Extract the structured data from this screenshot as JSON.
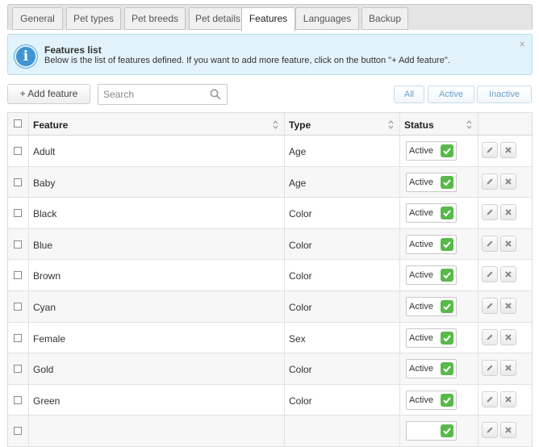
{
  "tabs": [
    {
      "label": "General"
    },
    {
      "label": "Pet types"
    },
    {
      "label": "Pet breeds"
    },
    {
      "label": "Pet details"
    },
    {
      "label": "Features"
    },
    {
      "label": "Languages"
    },
    {
      "label": "Backup"
    }
  ],
  "active_tab": "Features",
  "info": {
    "title": "Features list",
    "text": "Below is the list of features defined. If you want to add more feature, click on the button \"+ Add feature\".",
    "close": "×"
  },
  "toolbar": {
    "add_label": "+ Add feature",
    "search_placeholder": "Search",
    "filters": [
      "All",
      "Active",
      "Inactive"
    ]
  },
  "table": {
    "columns": [
      "Feature",
      "Type",
      "Status"
    ],
    "rows": [
      {
        "feature": "Adult",
        "type": "Age",
        "status": "Active"
      },
      {
        "feature": "Baby",
        "type": "Age",
        "status": "Active"
      },
      {
        "feature": "Black",
        "type": "Color",
        "status": "Active"
      },
      {
        "feature": "Blue",
        "type": "Color",
        "status": "Active"
      },
      {
        "feature": "Brown",
        "type": "Color",
        "status": "Active"
      },
      {
        "feature": "Cyan",
        "type": "Color",
        "status": "Active"
      },
      {
        "feature": "Female",
        "type": "Sex",
        "status": "Active"
      },
      {
        "feature": "Gold",
        "type": "Color",
        "status": "Active"
      },
      {
        "feature": "Green",
        "type": "Color",
        "status": "Active"
      },
      {
        "feature": "",
        "type": "",
        "status": ""
      }
    ]
  },
  "colors": {
    "accent_green": "#59b94b",
    "info_bg": "#e3f3fb",
    "filter_text": "#6aa0cc"
  }
}
